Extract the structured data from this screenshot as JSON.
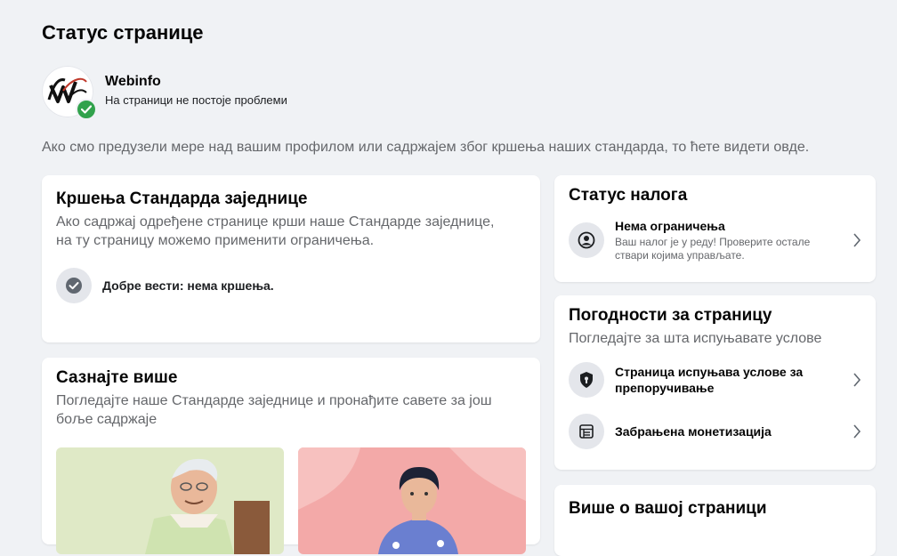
{
  "page": {
    "title": "Статус странице",
    "name": "Webinfo",
    "status": "На страници не постоје проблеми",
    "intro": "Ако смо предузели мере над вашим профилом или садржајем због кршења наших стандарда, то ћете видети овде."
  },
  "violations": {
    "title": "Кршења Стандарда заједнице",
    "subtitle_line1": "Ако садржај одређене странице крши наше Стандарде заједнице,",
    "subtitle_line2": "на ту страницу можемо применити ограничења.",
    "good_news": "Добре вести: нема кршења."
  },
  "learn_more": {
    "title": "Сазнајте више",
    "subtitle_line1": "Погледајте наше Стандарде заједнице и пронађите савете за још",
    "subtitle_line2": "боље садржаје"
  },
  "account_status": {
    "title": "Статус налога",
    "item_title": "Нема ограничења",
    "item_desc_line1": "Ваш налог је у реду! Проверите остале",
    "item_desc_line2": "ствари којима управљате."
  },
  "benefits": {
    "title": "Погодности за страницу",
    "subtitle": "Погледајте за шта испуњавате услове",
    "items": [
      {
        "label_line1": "Страница испуњава услове за",
        "label_line2": "препоручивање",
        "icon": "shield-icon"
      },
      {
        "label_line1": "Забрањена монетизација",
        "label_line2": "",
        "icon": "monetization-icon"
      }
    ]
  },
  "more": {
    "title": "Више о вашој страници"
  },
  "colors": {
    "background": "#f0f2f5",
    "card": "#ffffff",
    "success": "#31a24c",
    "secondary_text": "#65676b"
  }
}
